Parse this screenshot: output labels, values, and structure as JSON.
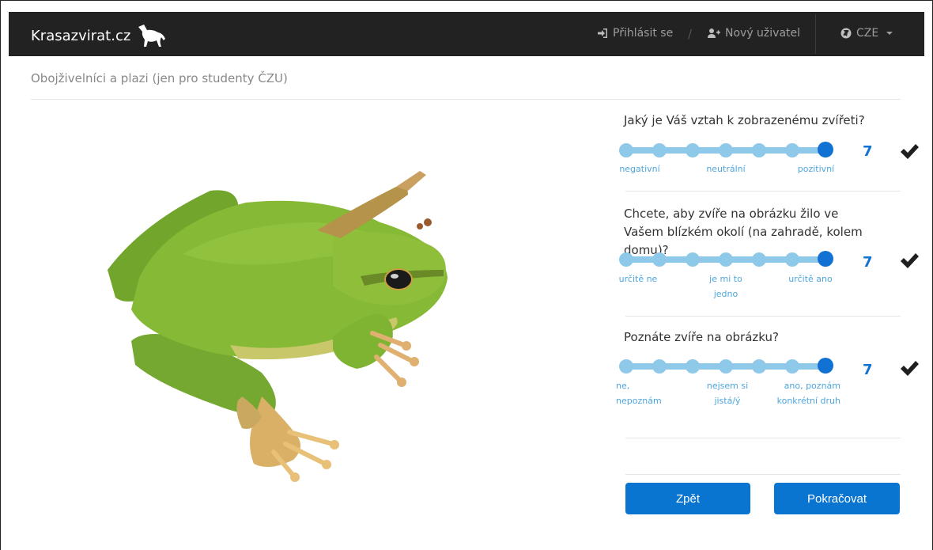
{
  "navbar": {
    "brand": "Krasazvirat.cz",
    "login_label": "Přihlásit se",
    "separator": "/",
    "new_user_label": "Nový uživatel",
    "language_label": "CZE"
  },
  "page": {
    "heading": "Obojživelníci a plazi (jen pro studenty ČZU)"
  },
  "questions": [
    {
      "text": "Jaký je Váš vztah k zobrazenému zvířeti?",
      "value": "7",
      "scale_max": 7,
      "labels": {
        "left": "negativní",
        "middle": "neutrální",
        "right": "pozitivní"
      }
    },
    {
      "text": "Chcete, aby zvíře na obrázku žilo ve Vašem blízkém okolí (na zahradě, kolem domu)?",
      "value": "7",
      "scale_max": 7,
      "labels": {
        "left": "určitě ne",
        "middle": "je mi to jedno",
        "right": "určitě ano"
      }
    },
    {
      "text": "Poznáte zvíře na obrázku?",
      "value": "7",
      "scale_max": 7,
      "labels": {
        "left": "ne, nepoznám",
        "middle": "nejsem si jistá/ý",
        "right": "ano, poznám konkrétní druh"
      }
    }
  ],
  "buttons": {
    "back_label": "Zpět",
    "continue_label": "Pokračovat"
  },
  "colors": {
    "navbar_bg": "#222222",
    "accent": "#1172d4",
    "slider_track": "#8ec9ea",
    "label_text": "#4fa6de"
  }
}
